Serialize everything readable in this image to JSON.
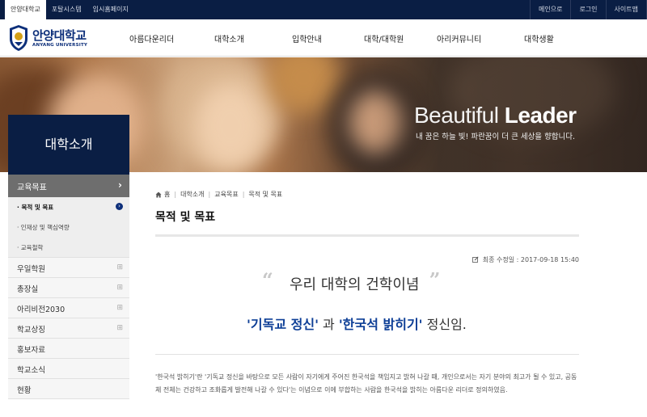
{
  "topbar": {
    "links": [
      "안양대학교",
      "포탈시스템",
      "입시홈페이지"
    ],
    "right_links": [
      "메인으로",
      "로그인",
      "사이트맵"
    ]
  },
  "logo": {
    "korean": "안양대학교",
    "english": "ANYANG UNIVERSITY"
  },
  "gnb": [
    "아름다운리더",
    "대학소개",
    "입학안내",
    "대학/대학원",
    "아리커뮤니티",
    "대학생활"
  ],
  "hero": {
    "slogan_light": "Beautiful",
    "slogan_bold": "Leader",
    "tagline": "내 꿈은 하늘 빛! 파란꿈이 더 큰 세상을 향합니다."
  },
  "lnb": {
    "title": "대학소개",
    "active": "교육목표",
    "sub_items": [
      "· 목적 및 목표",
      "· 인재상 및 핵심역량",
      "· 교육철학"
    ],
    "items": [
      "우일학원",
      "총장실",
      "아리비전2030",
      "학교상징",
      "홍보자료",
      "학교소식",
      "현황"
    ],
    "colors": {
      "title_bg": "#0a1e44",
      "active_bg": "#6e6e6e"
    }
  },
  "breadcrumb": [
    "홈",
    "대학소개",
    "교육목표",
    "목적 및 목표"
  ],
  "page_title": "목적 및 목표",
  "modified": "최종 수정일 : 2017-09-18 15:40",
  "heading": "우리 대학의 건학이념",
  "sub_heading": {
    "part1": "'기독교 정신'",
    "middle": " 과 ",
    "part2": "'한국석 밝히기'",
    "end": " 정신임."
  },
  "paragraph": "'한국석 밝히기'란 '기독교 정신을 바탕으로 모든 사람이 자기에게 주어진 한국석을 책임지고 밝혀 나갈 때, 개인으로서는 자기 분야의 최고가 될 수 있고, 공동체 전체는 건강하고 조화롭게 발전해 나갈 수 있다'는 이념으로 이에 부합하는 사람을 한국석을 밝히는 아름다운 리더로 정의하였음.",
  "colors": {
    "navy": "#0a1e44",
    "accent_blue": "#0d3e96"
  }
}
